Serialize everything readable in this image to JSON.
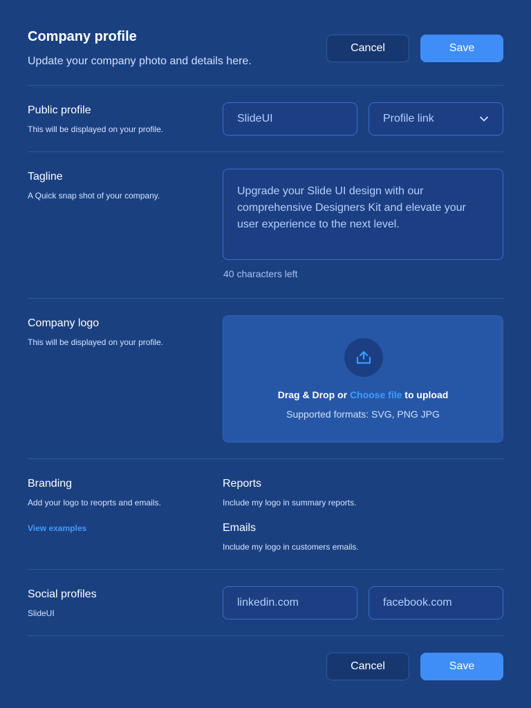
{
  "header": {
    "title": "Company profile",
    "subtitle": "Update your company photo and details here.",
    "cancel_label": "Cancel",
    "save_label": "Save"
  },
  "public_profile": {
    "label": "Public profile",
    "description": "This will be displayed on your profile.",
    "name_value": "SlideUI",
    "select_value": "Profile link"
  },
  "tagline": {
    "label": "Tagline",
    "description": "A Quick snap shot of your company.",
    "value": "Upgrade your Slide UI design with our comprehensive Designers Kit and elevate your user experience to the next level.",
    "counter": "40 characters left"
  },
  "company_logo": {
    "label": "Company logo",
    "description": "This will be displayed on your profile.",
    "drag_text_before": "Drag & Drop or",
    "choose_file_link": "Choose file",
    "drag_text_after": "to upload",
    "formats": "Supported formats: SVG, PNG JPG"
  },
  "branding": {
    "label": "Branding",
    "description": "Add your logo to reoprts and emails.",
    "view_examples": "View examples",
    "reports_label": "Reports",
    "reports_description": "Include my logo in summary reports.",
    "emails_label": "Emails",
    "emails_description": "Include my logo in customers emails."
  },
  "social": {
    "label": "Social profiles",
    "description": "SlideUI",
    "linkedin_value": "linkedin.com",
    "facebook_value": "facebook.com"
  },
  "footer": {
    "cancel_label": "Cancel",
    "save_label": "Save"
  },
  "colors": {
    "background": "#1a4080",
    "accent": "#3f8ef7",
    "link": "#3f9bff"
  },
  "icons": {
    "select": "chevron-down-icon",
    "upload": "upload-icon"
  }
}
